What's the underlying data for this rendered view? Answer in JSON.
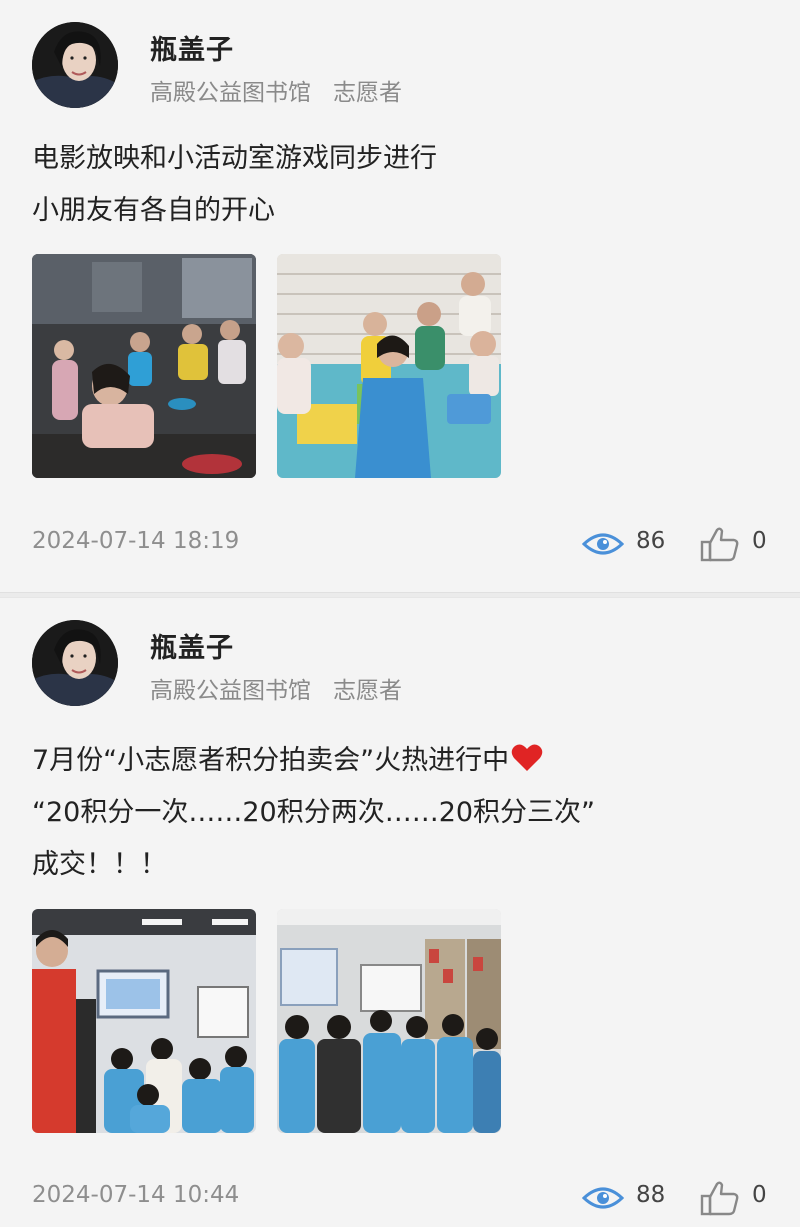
{
  "colors": {
    "background": "#f4f4f4",
    "name_text": "#222222",
    "meta_text": "#8a8a8a",
    "view_icon": "#4a90d9",
    "like_icon": "#888888",
    "heart": "#e02424"
  },
  "posts": [
    {
      "author": {
        "name": "瓶盖子",
        "organization": "高殿公益图书馆",
        "role": "志愿者",
        "avatar_icon": "avatar-photo"
      },
      "content": {
        "lines": [
          "电影放映和小活动室游戏同步进行",
          "小朋友有各自的开心"
        ]
      },
      "photos": [
        "movie-screening-photo",
        "playroom-games-photo"
      ],
      "timestamp": "2024-07-14 18:19",
      "views": "86",
      "likes": "0",
      "view_icon": "eye-icon",
      "like_icon": "thumbs-up-icon"
    },
    {
      "author": {
        "name": "瓶盖子",
        "organization": "高殿公益图书馆",
        "role": "志愿者",
        "avatar_icon": "avatar-photo"
      },
      "content": {
        "lines": [
          "7月份“小志愿者积分拍卖会”火热进行中",
          "“20积分一次……20积分两次……20积分三次”",
          "成交！！！"
        ],
        "line1_emoji": "red-heart-icon"
      },
      "photos": [
        "auction-classroom-photo",
        "auction-library-photo"
      ],
      "timestamp": "2024-07-14 10:44",
      "views": "88",
      "likes": "0",
      "view_icon": "eye-icon",
      "like_icon": "thumbs-up-icon"
    }
  ]
}
